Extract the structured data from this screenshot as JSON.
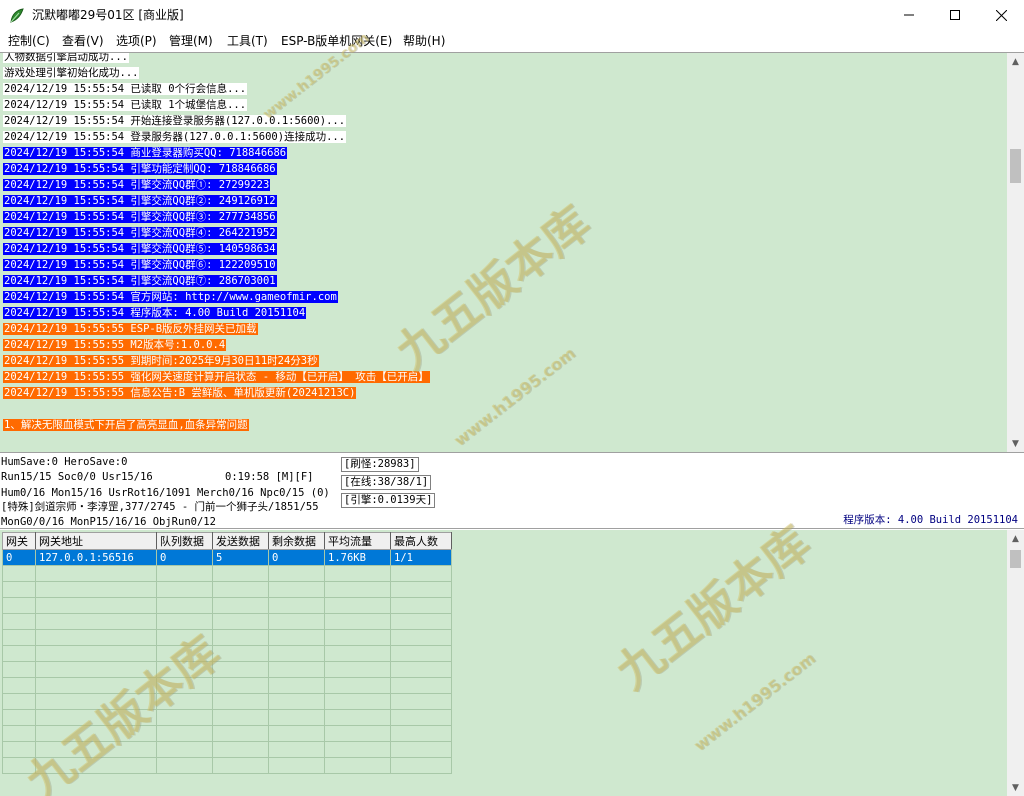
{
  "window": {
    "title": "沉默嘟嘟29号01区 [商业版]",
    "icon": "app-leaf-icon"
  },
  "menu": [
    "控制(C)",
    "查看(V)",
    "选项(P)",
    "管理(M)",
    "工具(T)",
    "ESP-B版单机网关(E)",
    "帮助(H)"
  ],
  "log": [
    {
      "text": "人物数据引擎启动成功...",
      "style": "none"
    },
    {
      "text": "游戏处理引擎初始化成功...",
      "style": "none"
    },
    {
      "text": "2024/12/19 15:55:54 已读取 0个行会信息...",
      "style": "none"
    },
    {
      "text": "2024/12/19 15:55:54 已读取 1个城堡信息...",
      "style": "none"
    },
    {
      "text": "2024/12/19 15:55:54 开始连接登录服务器(127.0.0.1:5600)...",
      "style": "none"
    },
    {
      "text": "2024/12/19 15:55:54 登录服务器(127.0.0.1:5600)连接成功...",
      "style": "none"
    },
    {
      "text": "2024/12/19 15:55:54 商业登录器购买QQ: 718846686",
      "style": "blue"
    },
    {
      "text": "2024/12/19 15:55:54 引擎功能定制QQ: 718846686",
      "style": "blue"
    },
    {
      "text": "2024/12/19 15:55:54 引擎交流QQ群①: 27299223",
      "style": "blue"
    },
    {
      "text": "2024/12/19 15:55:54 引擎交流QQ群②: 249126912",
      "style": "blue"
    },
    {
      "text": "2024/12/19 15:55:54 引擎交流QQ群③: 277734856",
      "style": "blue"
    },
    {
      "text": "2024/12/19 15:55:54 引擎交流QQ群④: 264221952",
      "style": "blue"
    },
    {
      "text": "2024/12/19 15:55:54 引擎交流QQ群⑤: 140598634",
      "style": "blue"
    },
    {
      "text": "2024/12/19 15:55:54 引擎交流QQ群⑥: 122209510",
      "style": "blue"
    },
    {
      "text": "2024/12/19 15:55:54 引擎交流QQ群⑦: 286703001",
      "style": "blue"
    },
    {
      "text": "2024/12/19 15:55:54 官方网站: http://www.gameofmir.com",
      "style": "blue"
    },
    {
      "text": "2024/12/19 15:55:54 程序版本: 4.00 Build 20151104",
      "style": "blue"
    },
    {
      "text": "2024/12/19 15:55:55 ESP-B版反外挂网关已加载",
      "style": "orange"
    },
    {
      "text": "2024/12/19 15:55:55 M2版本号:1.0.0.4",
      "style": "orange"
    },
    {
      "text": "2024/12/19 15:55:55 到期时间:2025年9月30日11时24分3秒",
      "style": "orange"
    },
    {
      "text": "2024/12/19 15:55:55 强化网关速度计算开启状态 - 移动【已开启】 攻击【已开启】",
      "style": "orange"
    },
    {
      "text": "2024/12/19 15:55:55 信息公告:B 尝鲜版、单机版更新(20241213C)",
      "style": "orange"
    },
    {
      "text": "",
      "style": "blank"
    },
    {
      "text": "1、解决无限血模式下开启了高亮显血,血条异常问题",
      "style": "orange"
    }
  ],
  "status": {
    "line1": "HumSave:0 HeroSave:0",
    "line2": "Run15/15 Soc0/0 Usr15/16",
    "time": "0:19:58 [M][F]",
    "line3": "Hum0/16 Mon15/16 UsrRot16/1091 Merch0/16 Npc0/15 (0)",
    "line4": "[特殊]剑道宗师・李淳罡,377/2745 - 门前一个狮子头/1851/55",
    "line5": "MonG0/0/16 MonP15/16/16 ObjRun0/12",
    "refresh": "[刷怪:28983]",
    "online": "[在线:38/38/1]",
    "engine": "[引擎:0.0139天]",
    "version": "程序版本: 4.00 Build 20151104"
  },
  "gateway_table": {
    "headers": [
      "网关",
      "网关地址",
      "队列数据",
      "发送数据",
      "剩余数据",
      "平均流量",
      "最高人数"
    ],
    "rows": [
      [
        "0",
        "127.0.0.1:56516",
        "0",
        "5",
        "0",
        "1.76KB",
        "1/1"
      ]
    ],
    "empty_rows": 13
  },
  "watermark": {
    "brand": "九五版本库",
    "url": "www.h1995.com"
  }
}
